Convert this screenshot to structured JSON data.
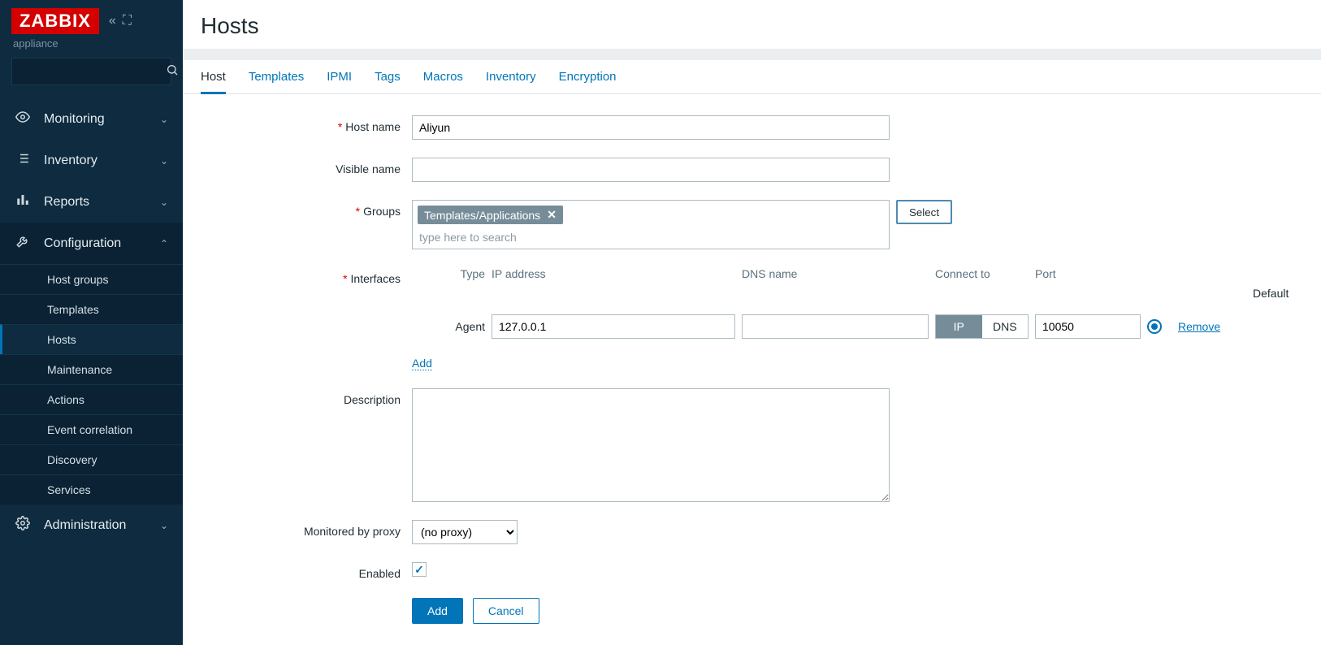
{
  "brand": "ZABBIX",
  "appliance_label": "appliance",
  "nav": {
    "sections": [
      {
        "label": "Monitoring",
        "icon": "eye"
      },
      {
        "label": "Inventory",
        "icon": "list"
      },
      {
        "label": "Reports",
        "icon": "bar-chart"
      },
      {
        "label": "Configuration",
        "icon": "wrench",
        "expanded": true
      },
      {
        "label": "Administration",
        "icon": "gear"
      }
    ],
    "config_items": [
      "Host groups",
      "Templates",
      "Hosts",
      "Maintenance",
      "Actions",
      "Event correlation",
      "Discovery",
      "Services"
    ],
    "active_config_item": "Hosts"
  },
  "page_title": "Hosts",
  "tabs": [
    "Host",
    "Templates",
    "IPMI",
    "Tags",
    "Macros",
    "Inventory",
    "Encryption"
  ],
  "active_tab": "Host",
  "form": {
    "labels": {
      "host_name": "Host name",
      "visible_name": "Visible name",
      "groups": "Groups",
      "interfaces": "Interfaces",
      "description": "Description",
      "monitored_by_proxy": "Monitored by proxy",
      "enabled": "Enabled"
    },
    "host_name": "Aliyun",
    "visible_name": "",
    "groups": {
      "selected": [
        "Templates/Applications"
      ],
      "placeholder": "type here to search",
      "select_button": "Select"
    },
    "interfaces": {
      "headers": {
        "type": "Type",
        "ip": "IP address",
        "dns": "DNS name",
        "connect_to": "Connect to",
        "port": "Port",
        "default": "Default"
      },
      "rows": [
        {
          "type": "Agent",
          "ip": "127.0.0.1",
          "dns": "",
          "connect_to": "IP",
          "connect_options": [
            "IP",
            "DNS"
          ],
          "port": "10050",
          "default": true
        }
      ],
      "add_label": "Add",
      "remove_label": "Remove"
    },
    "description": "",
    "proxy": {
      "value": "(no proxy)"
    },
    "enabled": true,
    "buttons": {
      "add": "Add",
      "cancel": "Cancel"
    }
  }
}
